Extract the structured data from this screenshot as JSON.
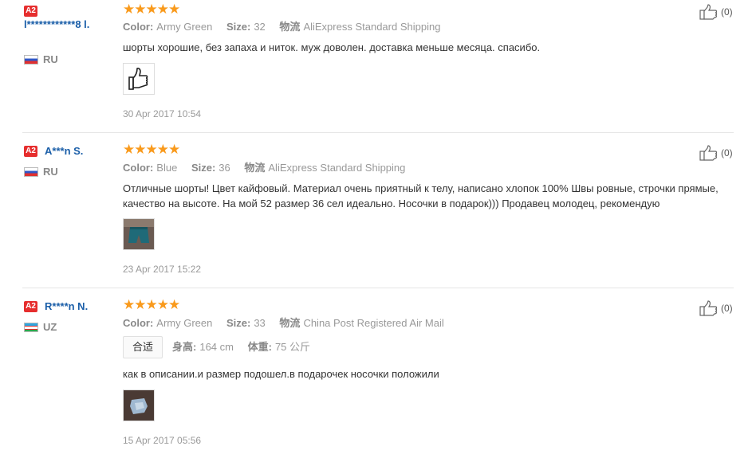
{
  "reviews": [
    {
      "badge": "A2",
      "username": "l************8 l.",
      "country": "RU",
      "stars": "★★★★★",
      "color_label": "Color:",
      "color_value": "Army Green",
      "size_label": "Size:",
      "size_value": "32",
      "shipping_label": "物流",
      "shipping_value": "AliExpress Standard Shipping",
      "text": "шорты хорошие, без запаха и ниток. муж доволен. доставка меньше месяца. спасибо.",
      "date": "30 Apr 2017 10:54",
      "helpful": "(0)"
    },
    {
      "badge": "A2",
      "username": "A***n S.",
      "country": "RU",
      "stars": "★★★★★",
      "color_label": "Color:",
      "color_value": "Blue",
      "size_label": "Size:",
      "size_value": "36",
      "shipping_label": "物流",
      "shipping_value": "AliExpress Standard Shipping",
      "text": "Отличные шорты! Цвет кайфовый. Материал очень приятный к телу, написано хлопок 100% Швы ровные, строчки прямые, качество на высоте. На мой 52 размер 36 сел идеально. Носочки в подарок))) Продавец молодец, рекомендую",
      "date": "23 Apr 2017 15:22",
      "helpful": "(0)"
    },
    {
      "badge": "A2",
      "username": "R****n N.",
      "country": "UZ",
      "stars": "★★★★★",
      "color_label": "Color:",
      "color_value": "Army Green",
      "size_label": "Size:",
      "size_value": "33",
      "shipping_label": "物流",
      "shipping_value": "China Post Registered Air Mail",
      "fit": "合适",
      "height_label": "身高:",
      "height_value": "164 cm",
      "weight_label": "体重:",
      "weight_value": "75 公斤",
      "text": "как в описании.и размер подошел.в подарочек носочки положили",
      "date": "15 Apr 2017 05:56",
      "helpful": "(0)"
    }
  ],
  "colors": {
    "accent_star": "#f99a1c",
    "badge": "#e62e2e",
    "username": "#1a5ea8"
  },
  "icons": {
    "helpful": "thumbs-up-icon"
  }
}
